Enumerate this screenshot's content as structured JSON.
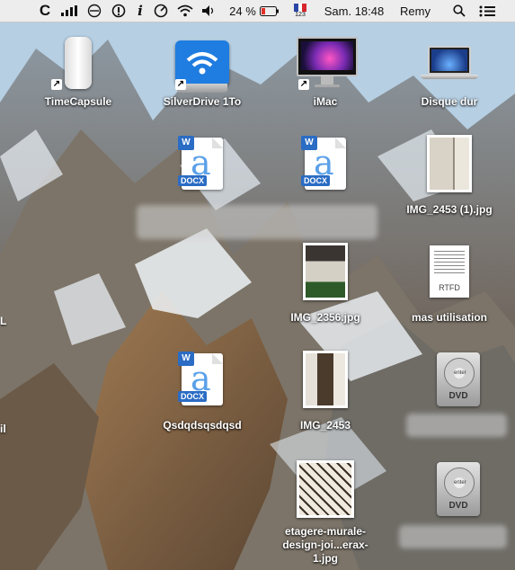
{
  "menubar": {
    "items": [
      {
        "name": "ccleaner-icon",
        "glyph": "C"
      },
      {
        "name": "signal-icon"
      },
      {
        "name": "time-machine-icon",
        "glyph": "⦸"
      },
      {
        "name": "istat-icon",
        "glyph": "⓪"
      },
      {
        "name": "info-icon",
        "glyph": "i"
      },
      {
        "name": "speedometer-icon",
        "glyph": "◴"
      },
      {
        "name": "wifi-icon"
      },
      {
        "name": "volume-icon",
        "glyph": "🔊"
      }
    ],
    "battery_text": "24 %",
    "input_source": "123",
    "clock": "Sam. 18:48",
    "user": "Remy"
  },
  "desktop": {
    "icons": [
      {
        "id": "timecapsule",
        "label": "TimeCapsule",
        "icon": "time-capsule-icon",
        "alias": true
      },
      {
        "id": "silverdrive",
        "label": "SilverDrive 1To",
        "icon": "external-drive-icon",
        "alias": true
      },
      {
        "id": "imac",
        "label": "iMac",
        "icon": "imac-icon",
        "alias": true
      },
      {
        "id": "disque",
        "label": "Disque dur",
        "icon": "laptop-icon",
        "alias": false
      },
      {
        "id": "docx1",
        "label": "",
        "ext": "DOCX",
        "badge": "W",
        "icon": "docx-icon"
      },
      {
        "id": "docx2",
        "label": "",
        "ext": "DOCX",
        "badge": "W",
        "icon": "docx-icon"
      },
      {
        "id": "img2453_1",
        "label": "IMG_2453 (1).jpg",
        "icon": "jpg-thumbnail-icon"
      },
      {
        "id": "img2356",
        "label": "IMG_2356.jpg",
        "icon": "jpg-thumbnail-icon"
      },
      {
        "id": "masutil",
        "label": "mas utilisation",
        "ext": "RTFD",
        "icon": "rtfd-icon"
      },
      {
        "id": "docx3",
        "label": "Qsdqdsqsdqsd",
        "ext": "DOCX",
        "badge": "W",
        "icon": "docx-icon"
      },
      {
        "id": "img2453",
        "label": "IMG_2453",
        "icon": "jpg-thumbnail-icon"
      },
      {
        "id": "dvd1",
        "label": "",
        "ext": "DVD",
        "icon": "dvd-icon"
      },
      {
        "id": "etagere",
        "label": "etagere-murale-design-joi...erax-1.jpg",
        "icon": "jpg-thumbnail-icon"
      },
      {
        "id": "dvd2",
        "label": "",
        "ext": "DVD",
        "icon": "dvd-icon"
      }
    ],
    "partial_left_labels": [
      "L",
      "il"
    ]
  },
  "dvd_enter_text": "enter",
  "colors": {
    "menubar": "#ececec",
    "battery_low": "#e0302a",
    "docx_blue": "#2b6cc4",
    "wifi_drive_blue": "#1f7ce0"
  }
}
